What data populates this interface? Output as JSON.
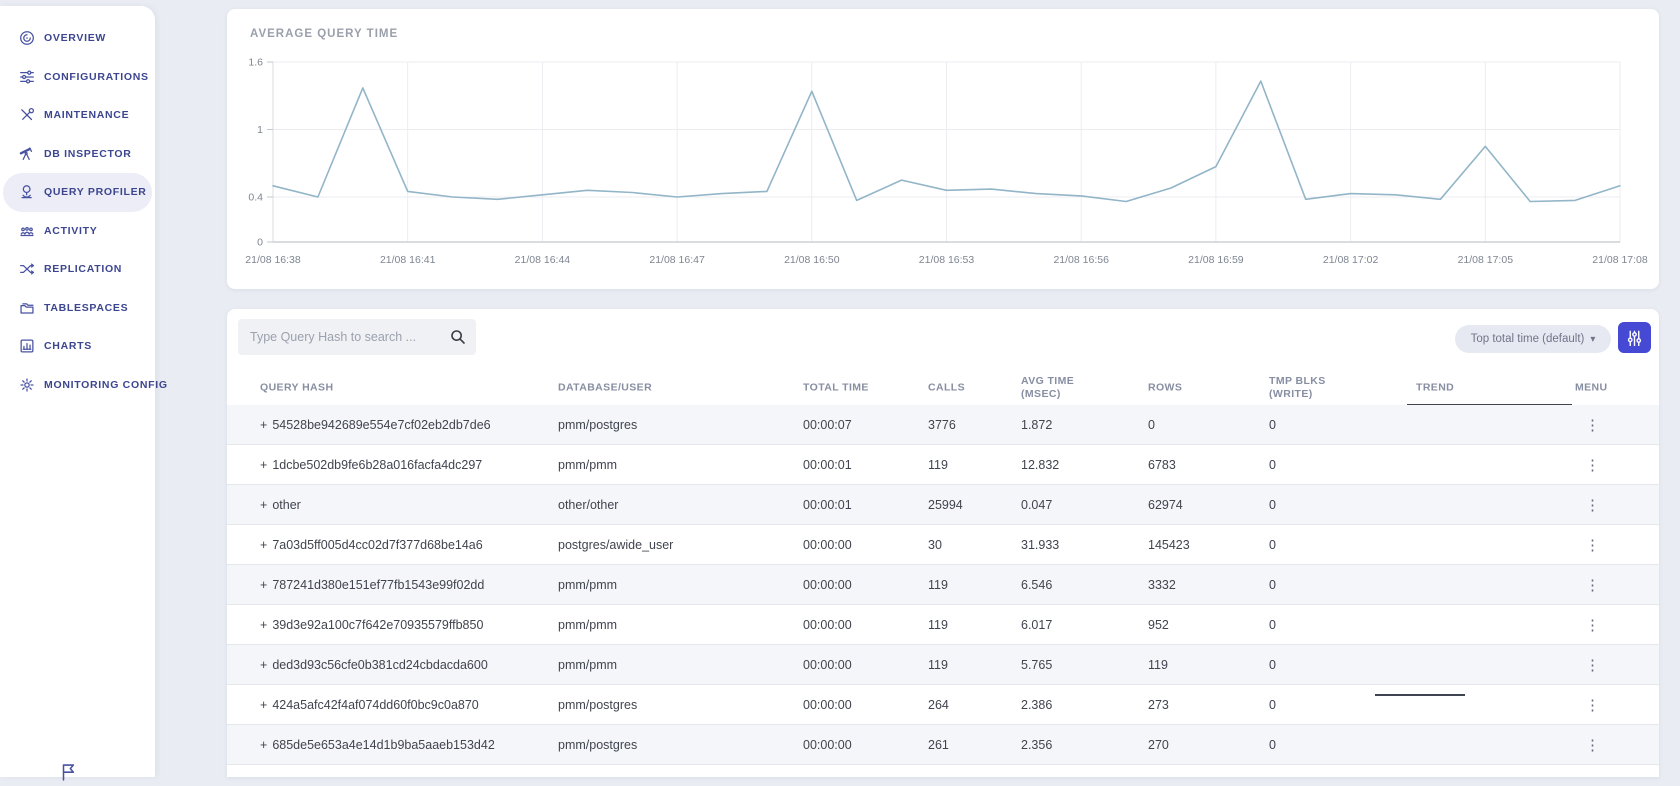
{
  "sidebar": {
    "items": [
      {
        "label": "OVERVIEW",
        "icon": "overview-icon",
        "active": false
      },
      {
        "label": "CONFIGURATIONS",
        "icon": "configurations-icon",
        "active": false
      },
      {
        "label": "MAINTENANCE",
        "icon": "maintenance-icon",
        "active": false
      },
      {
        "label": "DB INSPECTOR",
        "icon": "db-inspector-icon",
        "active": false
      },
      {
        "label": "QUERY PROFILER",
        "icon": "query-profiler-icon",
        "active": true
      },
      {
        "label": "ACTIVITY",
        "icon": "activity-icon",
        "active": false
      },
      {
        "label": "REPLICATION",
        "icon": "replication-icon",
        "active": false
      },
      {
        "label": "TABLESPACES",
        "icon": "tablespaces-icon",
        "active": false
      },
      {
        "label": "CHARTS",
        "icon": "charts-icon",
        "active": false
      },
      {
        "label": "MONITORING CONFIG",
        "icon": "monitoring-config-icon",
        "active": false
      }
    ],
    "footer_icon": "flag-icon"
  },
  "chart": {
    "title": "AVERAGE QUERY TIME"
  },
  "chart_data": {
    "type": "line",
    "title": "AVERAGE QUERY TIME",
    "x": [
      "21/08 16:38",
      "21/08 16:39",
      "21/08 16:40",
      "21/08 16:41",
      "21/08 16:42",
      "21/08 16:43",
      "21/08 16:44",
      "21/08 16:45",
      "21/08 16:46",
      "21/08 16:47",
      "21/08 16:48",
      "21/08 16:49",
      "21/08 16:50",
      "21/08 16:51",
      "21/08 16:52",
      "21/08 16:53",
      "21/08 16:54",
      "21/08 16:55",
      "21/08 16:56",
      "21/08 16:57",
      "21/08 16:58",
      "21/08 16:59",
      "21/08 17:00",
      "21/08 17:01",
      "21/08 17:02",
      "21/08 17:03",
      "21/08 17:04",
      "21/08 17:05",
      "21/08 17:06",
      "21/08 17:07",
      "21/08 17:08"
    ],
    "values": [
      0.5,
      0.4,
      1.37,
      0.45,
      0.4,
      0.38,
      0.42,
      0.46,
      0.44,
      0.4,
      0.43,
      0.45,
      1.34,
      0.37,
      0.55,
      0.46,
      0.47,
      0.43,
      0.41,
      0.36,
      0.48,
      0.67,
      1.43,
      0.38,
      0.43,
      0.42,
      0.38,
      0.85,
      0.36,
      0.37,
      0.5
    ],
    "xticks": [
      "21/08 16:38",
      "21/08 16:41",
      "21/08 16:44",
      "21/08 16:47",
      "21/08 16:50",
      "21/08 16:53",
      "21/08 16:56",
      "21/08 16:59",
      "21/08 17:02",
      "21/08 17:05",
      "21/08 17:08"
    ],
    "yticks": [
      0,
      0.4,
      1,
      1.6
    ],
    "ytick_labels": [
      "0",
      "0.4",
      "1",
      "1.6"
    ],
    "ylim": [
      0,
      1.6
    ],
    "xlabel": "",
    "ylabel": "",
    "grid": true,
    "legend": "none",
    "line_color": "#92b5c8"
  },
  "toolbar": {
    "search_placeholder": "Type Query Hash to search ...",
    "search_value": "",
    "search_icon": "search-icon",
    "sort_label": "Top total time (default)",
    "filter_icon": "sliders-icon"
  },
  "table": {
    "expand_symbol": "+",
    "menu_icon": "kebab-icon",
    "columns": [
      {
        "label": "QUERY HASH"
      },
      {
        "label": "DATABASE/USER"
      },
      {
        "label": "TOTAL TIME"
      },
      {
        "label": "CALLS"
      },
      {
        "label": "AVG TIME\n(MSEC)"
      },
      {
        "label": "ROWS"
      },
      {
        "label": "TMP BLKS\n(WRITE)"
      },
      {
        "label": "TREND"
      },
      {
        "label": "MENU"
      }
    ],
    "rows": [
      {
        "hash": "54528be942689e554e7cf02eb2db7de6",
        "db_user": "pmm/postgres",
        "total_time": "00:00:07",
        "calls": "3776",
        "avg_time": "1.872",
        "rows": "0",
        "tmp_blks": "0"
      },
      {
        "hash": "1dcbe502db9fe6b28a016facfa4dc297",
        "db_user": "pmm/pmm",
        "total_time": "00:00:01",
        "calls": "119",
        "avg_time": "12.832",
        "rows": "6783",
        "tmp_blks": "0"
      },
      {
        "hash": "other",
        "db_user": "other/other",
        "total_time": "00:00:01",
        "calls": "25994",
        "avg_time": "0.047",
        "rows": "62974",
        "tmp_blks": "0"
      },
      {
        "hash": "7a03d5ff005d4cc02d7f377d68be14a6",
        "db_user": "postgres/awide_user",
        "total_time": "00:00:00",
        "calls": "30",
        "avg_time": "31.933",
        "rows": "145423",
        "tmp_blks": "0"
      },
      {
        "hash": "787241d380e151ef77fb1543e99f02dd",
        "db_user": "pmm/pmm",
        "total_time": "00:00:00",
        "calls": "119",
        "avg_time": "6.546",
        "rows": "3332",
        "tmp_blks": "0"
      },
      {
        "hash": "39d3e92a100c7f642e70935579ffb850",
        "db_user": "pmm/pmm",
        "total_time": "00:00:00",
        "calls": "119",
        "avg_time": "6.017",
        "rows": "952",
        "tmp_blks": "0"
      },
      {
        "hash": "ded3d93c56cfe0b381cd24cbdacda600",
        "db_user": "pmm/pmm",
        "total_time": "00:00:00",
        "calls": "119",
        "avg_time": "5.765",
        "rows": "119",
        "tmp_blks": "0"
      },
      {
        "hash": "424a5afc42f4af074dd60f0bc9c0a870",
        "db_user": "pmm/postgres",
        "total_time": "00:00:00",
        "calls": "264",
        "avg_time": "2.386",
        "rows": "273",
        "tmp_blks": "0"
      },
      {
        "hash": "685de5e653a4e14d1b9ba5aaeb153d42",
        "db_user": "pmm/postgres",
        "total_time": "00:00:00",
        "calls": "261",
        "avg_time": "2.356",
        "rows": "270",
        "tmp_blks": "0"
      }
    ]
  },
  "colors": {
    "accent": "#4549d3",
    "sidebar_text": "#3c468f",
    "chart_line": "#92b5c8",
    "zebra_row": "#f4f6f9",
    "header_text": "#878ea2"
  }
}
